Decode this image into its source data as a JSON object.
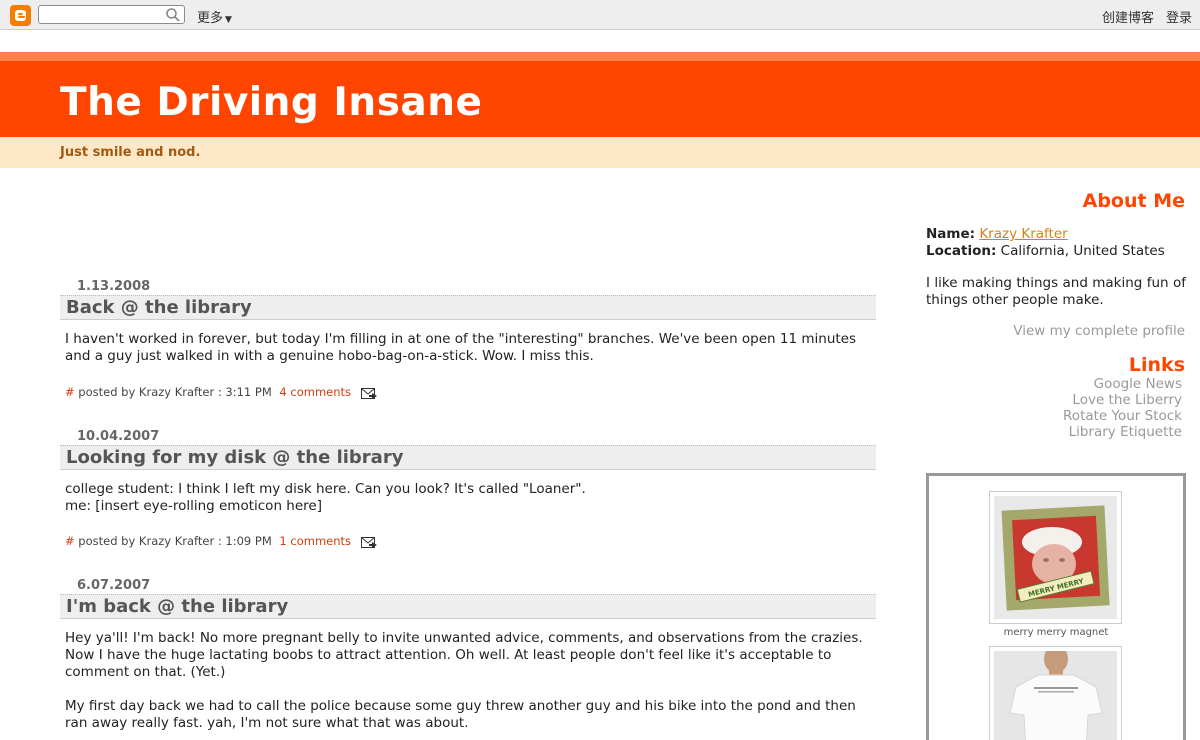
{
  "navbar": {
    "search_placeholder": "",
    "more_label": "更多",
    "create_blog_label": "创建博客",
    "login_label": "登录"
  },
  "blog": {
    "title": "The Driving Insane",
    "description": "Just smile and nod."
  },
  "posts": [
    {
      "date": "1.13.2008",
      "title": "Back @ the library",
      "paragraphs": [
        "I haven't worked in forever, but today I'm filling in at one of the \"interesting\" branches. We've been open 11 minutes and a guy just walked in with a genuine hobo-bag-on-a-stick. Wow. I miss this."
      ],
      "footer_text": " posted by Krazy Krafter : 3:11 PM",
      "comments": "4 comments"
    },
    {
      "date": "10.04.2007",
      "title": "Looking for my disk @ the library",
      "paragraphs": [
        "college student: I think I left my disk here. Can you look? It's called \"Loaner\".",
        "me: [insert eye-rolling emoticon here]"
      ],
      "footer_text": " posted by Krazy Krafter : 1:09 PM",
      "comments": "1 comments"
    },
    {
      "date": "6.07.2007",
      "title": "I'm back @ the library",
      "paragraphs": [
        "Hey ya'll! I'm back! No more pregnant belly to invite unwanted advice, comments, and observations from the crazies. Now I have the huge lactating boobs to attract attention. Oh well. At least people don't feel like it's acceptable to comment on that. (Yet.)",
        "My first day back we had to call the police because some guy threw another guy and his bike into the pond and then ran away really fast. yah, I'm not sure what that was about."
      ]
    }
  ],
  "post_hash": "#",
  "sidebar": {
    "about_heading": "About Me",
    "name_label": "Name:",
    "name_value": "Krazy Krafter",
    "location_label": "Location:",
    "location_value": "California, United States",
    "about_text": "I like making things and making fun of things other people make.",
    "view_profile": "View my complete profile",
    "links_heading": "Links",
    "links": [
      "Google News",
      "Love the Liberry",
      "Rotate Your Stock",
      "Library Etiquette"
    ],
    "widget": {
      "item1_caption": "merry merry magnet",
      "item1_text": "MERRY MERRY"
    }
  },
  "colors": {
    "header_orange": "#ff4500",
    "desc_band": "#ffe8c8",
    "link_orange": "#d43d0d"
  }
}
